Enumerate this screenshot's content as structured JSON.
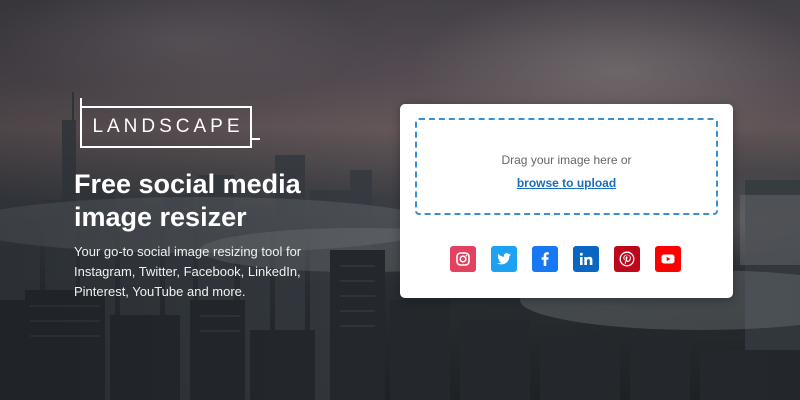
{
  "logo": {
    "text": "LANDSCAPE"
  },
  "hero": {
    "title": "Free social media image resizer",
    "subtitle": "Your go-to social image resizing tool for Instagram, Twitter, Facebook, LinkedIn, Pinterest, YouTube and more."
  },
  "upload": {
    "drag_text": "Drag your image here or",
    "browse_label": "browse to upload"
  },
  "social": [
    {
      "name": "Instagram",
      "icon": "instagram-icon",
      "color": "#e4405f"
    },
    {
      "name": "Twitter",
      "icon": "twitter-icon",
      "color": "#1da1f2"
    },
    {
      "name": "Facebook",
      "icon": "facebook-icon",
      "color": "#1877f2"
    },
    {
      "name": "LinkedIn",
      "icon": "linkedin-icon",
      "color": "#0a66c2"
    },
    {
      "name": "Pinterest",
      "icon": "pinterest-icon",
      "color": "#bd081c"
    },
    {
      "name": "YouTube",
      "icon": "youtube-icon",
      "color": "#ff0000"
    }
  ],
  "colors": {
    "dropzone_border": "#3a8fd0",
    "link": "#1a6fb8",
    "card_bg": "#ffffff"
  }
}
